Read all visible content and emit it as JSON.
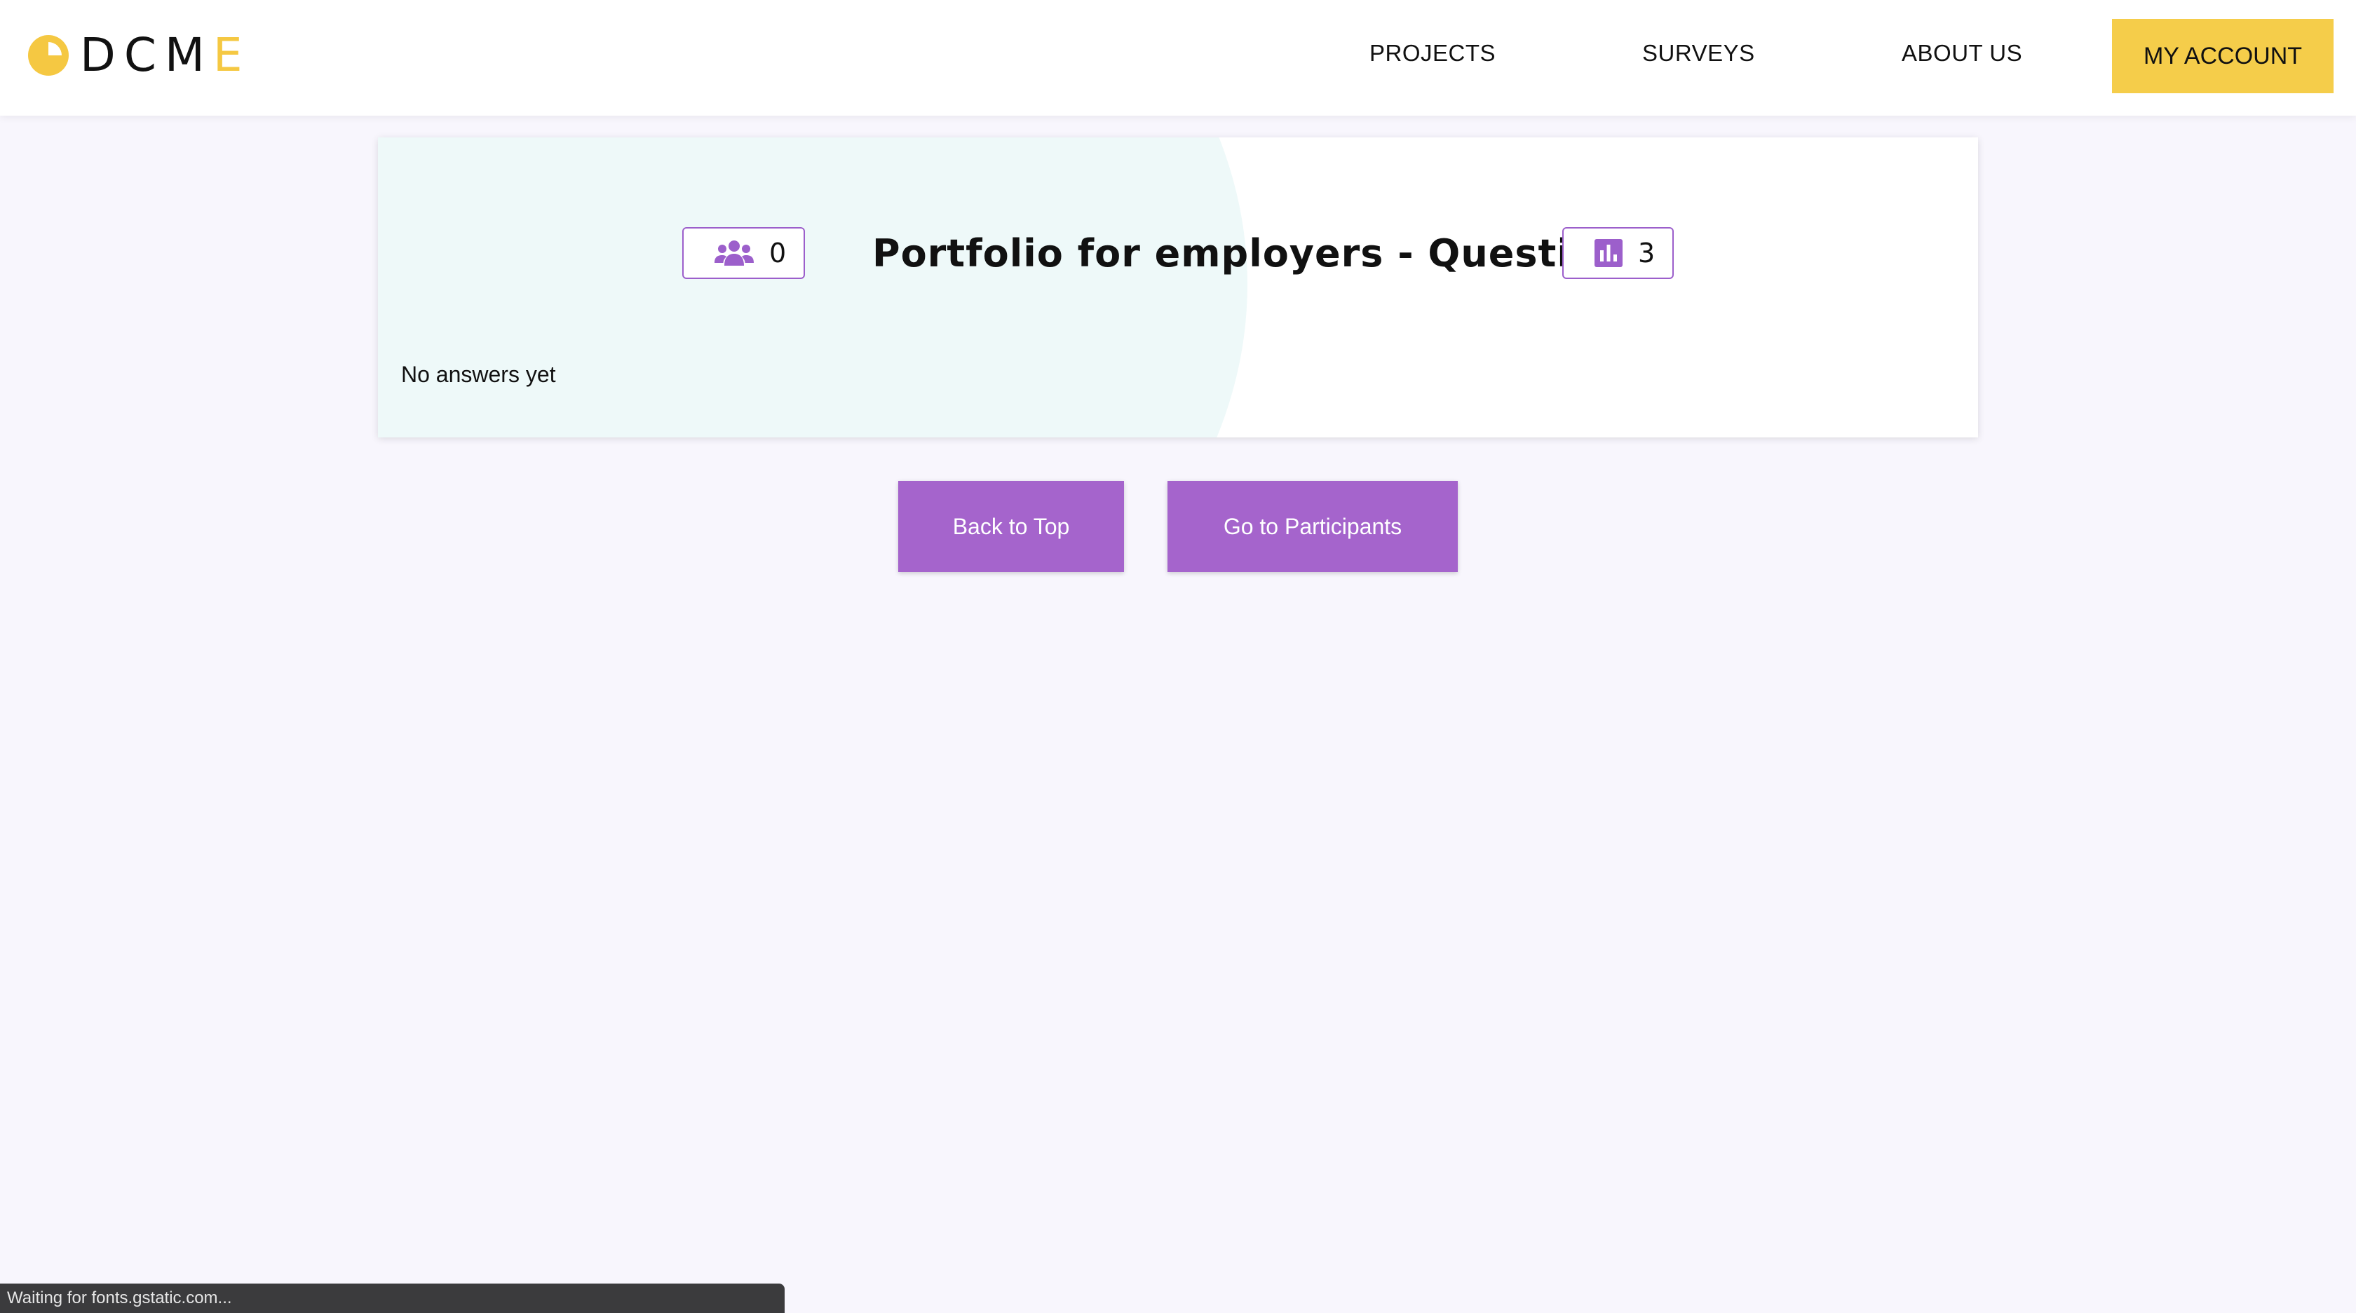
{
  "header": {
    "logo": {
      "text_main": "DCM",
      "text_accent": "E"
    },
    "nav": {
      "projects": "PROJECTS",
      "surveys": "SURVEYS",
      "about": "ABOUT US"
    },
    "account_label": "MY ACCOUNT"
  },
  "survey_card": {
    "title": "Portfolio for employers - Questions",
    "participants_count": "0",
    "questions_count": "3",
    "participants_icon": "users-icon",
    "questions_icon": "bar-chart-icon",
    "note": "No answers yet"
  },
  "actions": {
    "back_to_top": "Back to Top",
    "go_to_participants": "Go to Participants"
  },
  "browser_status": "Waiting for fonts.gstatic.com...",
  "colors": {
    "brand_yellow": "#f5cd4a",
    "accent_purple": "#a564cc",
    "page_background": "#f8f6fd",
    "card_blob": "#eef9f9"
  }
}
